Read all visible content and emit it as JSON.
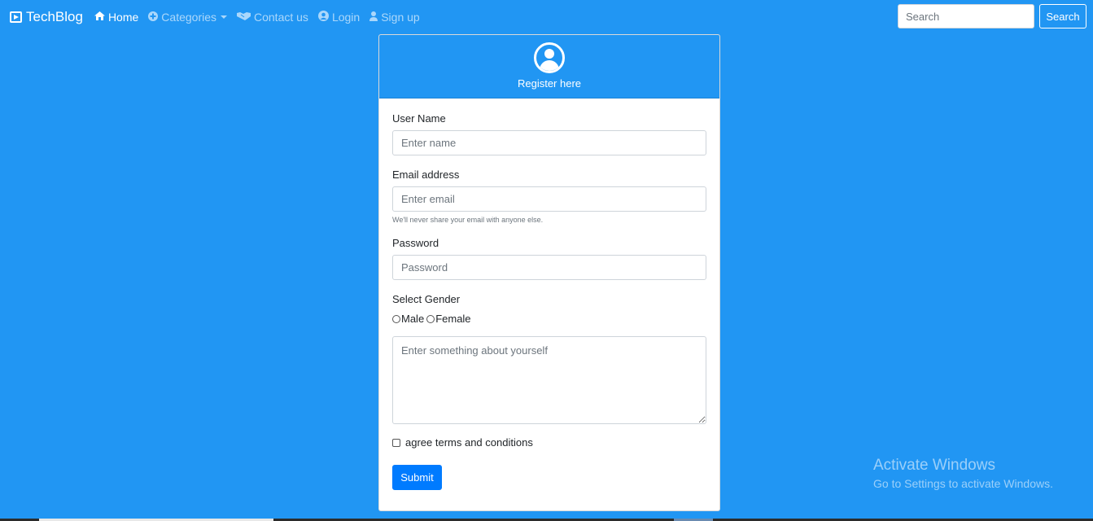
{
  "nav": {
    "brand": "TechBlog",
    "items": [
      {
        "label": "Home",
        "icon": "home-icon"
      },
      {
        "label": "Categories",
        "icon": "plus-circle-icon"
      },
      {
        "label": "Contact us",
        "icon": "handshake-icon"
      },
      {
        "label": "Login",
        "icon": "user-circle-icon"
      },
      {
        "label": "Sign up",
        "icon": "user-icon"
      }
    ],
    "search_placeholder": "Search",
    "search_button": "Search"
  },
  "card": {
    "title": "Register here",
    "username_label": "User Name",
    "username_placeholder": "Enter name",
    "email_label": "Email address",
    "email_placeholder": "Enter email",
    "email_help": "We'll never share your email with anyone else.",
    "password_label": "Password",
    "password_placeholder": "Password",
    "gender_label": "Select Gender",
    "gender_options": [
      "Male",
      "Female"
    ],
    "about_placeholder": "Enter something about yourself",
    "terms_label": "agree terms and conditions",
    "submit_label": "Submit"
  },
  "watermark": {
    "title": "Activate Windows",
    "subtitle": "Go to Settings to activate Windows."
  },
  "colors": {
    "background": "#2196f3",
    "primary_button": "#007bff"
  }
}
